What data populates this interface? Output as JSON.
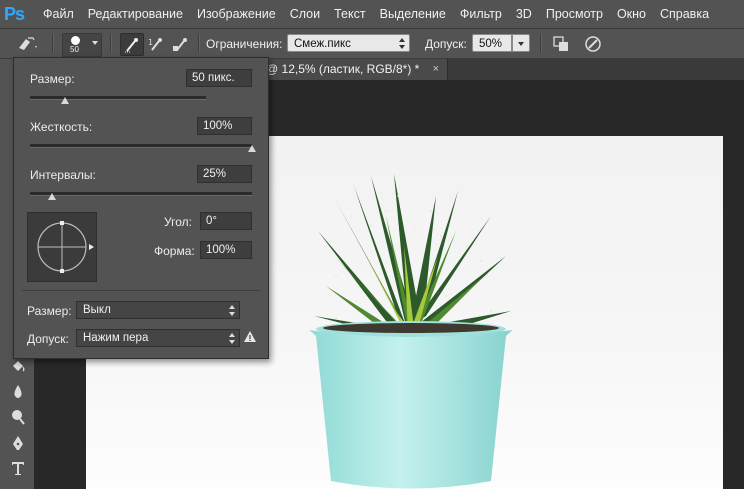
{
  "app": {
    "logo": "Ps"
  },
  "menu": [
    "Файл",
    "Редактирование",
    "Изображение",
    "Слои",
    "Текст",
    "Выделение",
    "Фильтр",
    "3D",
    "Просмотр",
    "Окно",
    "Справка"
  ],
  "options": {
    "brush_size": "50",
    "limits_label": "Ограничения:",
    "limits_value": "Смеж.пикс",
    "tolerance_label": "Допуск:",
    "tolerance_value": "50%"
  },
  "document": {
    "tab_title": "@ 12,5% (ластик, RGB/8*) *",
    "close_glyph": "×"
  },
  "brush_panel": {
    "size_label": "Размер:",
    "size_value": "50 пикс.",
    "size_level": 0.2,
    "hardness_label": "Жесткость:",
    "hardness_value": "100%",
    "hardness_level": 1.0,
    "spacing_label": "Интервалы:",
    "spacing_value": "25%",
    "spacing_level": 0.1,
    "angle_label": "Угол:",
    "angle_value": "0°",
    "roundness_label": "Форма:",
    "roundness_value": "100%",
    "dyn_size_label": "Размер:",
    "dyn_size_value": "Выкл",
    "dyn_tol_label": "Допуск:",
    "dyn_tol_value": "Нажим пера"
  },
  "icons": {
    "tool_preset": "background-eraser-icon",
    "sampling": [
      "sampling-continuous-icon",
      "sampling-once-icon",
      "sampling-swatch-icon"
    ],
    "protect": "protect-foreground-icon",
    "pressure": "pen-pressure-icon",
    "warning": "warning-icon",
    "tools": [
      "paint-bucket-icon",
      "blur-icon",
      "dodge-icon",
      "pen-icon",
      "type-icon"
    ]
  },
  "colors": {
    "pot": "#a9e6e3",
    "pot_shadow": "#7fcfcb",
    "plant_dark": "#2d5a2a",
    "plant_light": "#a6cb3a",
    "accent": "#31a8ff"
  }
}
